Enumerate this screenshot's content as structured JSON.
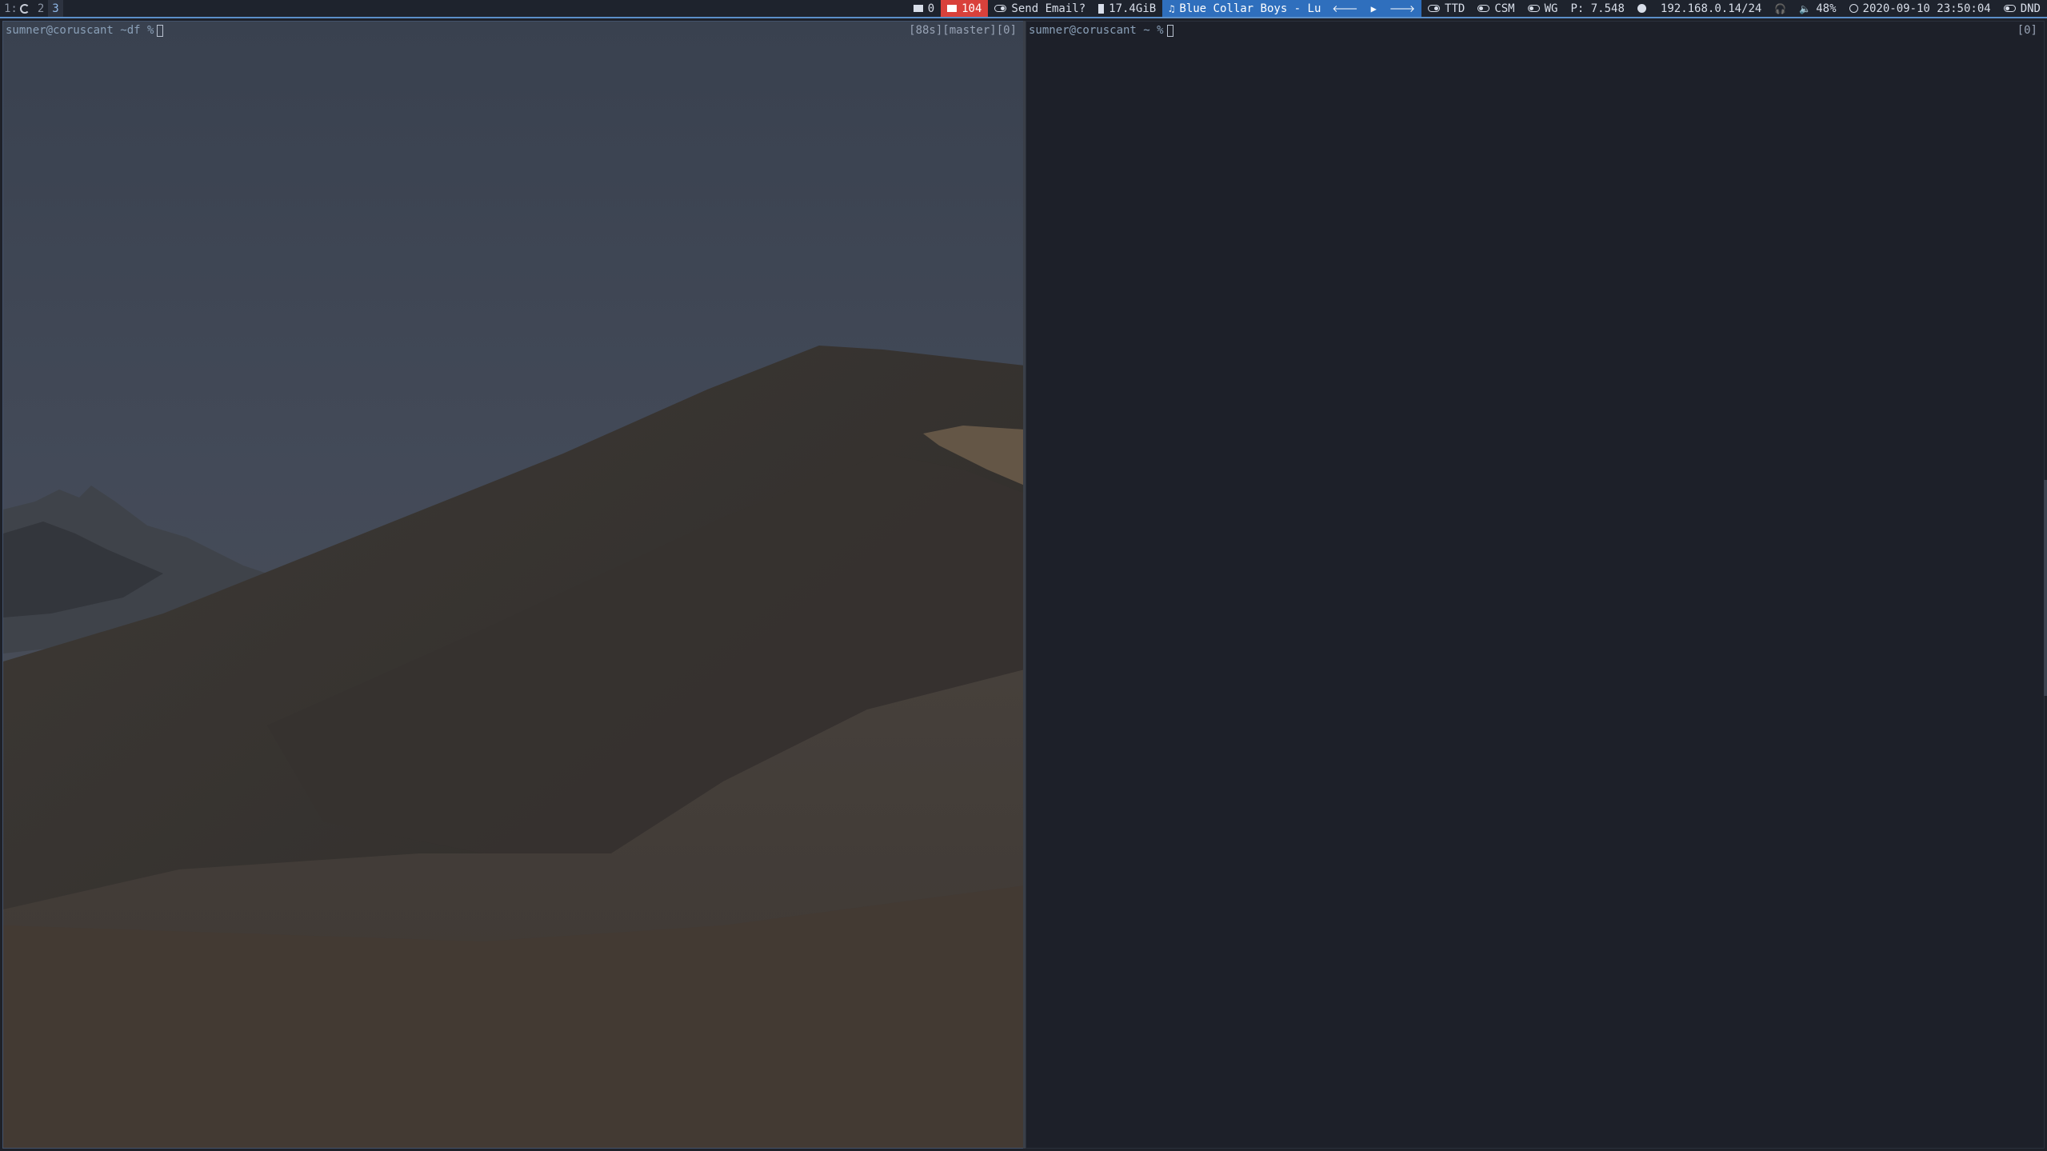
{
  "bar": {
    "workspaces": [
      {
        "label": "1:",
        "active": false
      },
      {
        "label": "2",
        "active": false
      },
      {
        "label": "3",
        "active": true
      }
    ],
    "mail_unread": "0",
    "mail_alert": "104",
    "send_email": "Send Email?",
    "disk": "17.4GiB",
    "music_track": "Blue Collar Boys - Lu",
    "ttd": "TTD",
    "csm": "CSM",
    "wg": "WG",
    "price": "P: 7.548",
    "ip": "192.168.0.14/24",
    "volume": "48%",
    "datetime": "2020-09-10 23:50:04",
    "dnd": "DND",
    "colors": {
      "alert": "#d9413b",
      "accent": "#2f6fbd",
      "bar_bg": "#1e232d"
    }
  },
  "left_terminal": {
    "prompt": "sumner@coruscant ~df %",
    "rprompt": "[88s][master][0]"
  },
  "right_terminal": {
    "prompt": "sumner@coruscant ~ %",
    "rprompt": "[0]"
  }
}
